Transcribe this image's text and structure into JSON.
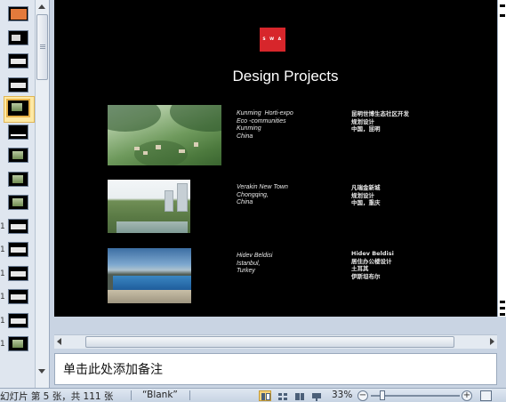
{
  "thumbnails": {
    "items": [
      {
        "num": "",
        "kind": "red"
      },
      {
        "num": "",
        "kind": "mark"
      },
      {
        "num": "",
        "kind": "white"
      },
      {
        "num": "",
        "kind": "white"
      },
      {
        "num": "",
        "kind": "land",
        "selected": true
      },
      {
        "num": "",
        "kind": "bar"
      },
      {
        "num": "",
        "kind": "land"
      },
      {
        "num": "",
        "kind": "land"
      },
      {
        "num": "",
        "kind": "land"
      },
      {
        "num": "1",
        "kind": "white"
      },
      {
        "num": "1",
        "kind": "white"
      },
      {
        "num": "1",
        "kind": "white"
      },
      {
        "num": "1",
        "kind": "white"
      },
      {
        "num": "1",
        "kind": "white"
      },
      {
        "num": "1",
        "kind": "land"
      }
    ]
  },
  "slide": {
    "logo": "S W A",
    "title": "Design Projects",
    "projects": [
      {
        "en": "Kunming  Horti-expo\nEco -communities\nKunming\nChina",
        "cn": "昆明世博生态社区开发\n规划设计\n中国，昆明"
      },
      {
        "en": "Verakin New Town\nChongqing,\nChina",
        "cn": "凡瑞金新城\n规划设计\n中国，重庆"
      },
      {
        "en": "Hidev Beldisi\nIstanbul,\nTurkey",
        "cn": "Hidev Beldisi\n居住办公楼设计\n土耳其\n伊斯坦布尔"
      }
    ]
  },
  "notes": {
    "placeholder": "单击此处添加备注"
  },
  "status": {
    "slide_info": "幻灯片 第 5 张，共 111 张",
    "theme": "“Blank”",
    "zoom": "33%",
    "zoom_out": "−",
    "zoom_in": "+"
  },
  "colors": {
    "slide_bg": "#000000",
    "logo_red": "#d7262b",
    "selected_thumb": "#e8b34a"
  }
}
